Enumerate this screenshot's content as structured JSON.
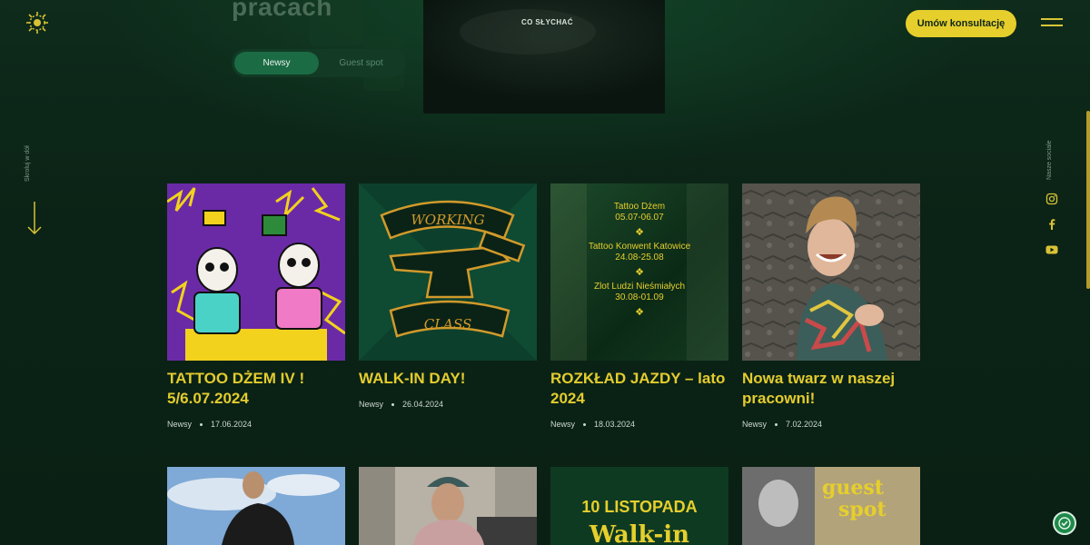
{
  "header": {
    "hero_title": "pracach",
    "nav_label": "CO SŁYCHAĆ",
    "cta_label": "Umów konsultację"
  },
  "tabs": [
    {
      "label": "Newsy"
    },
    {
      "label": "Guest spot"
    }
  ],
  "side": {
    "scroll_label": "Skroluj w dół",
    "social_label": "Nasze sociale"
  },
  "icons": {
    "logo": "sun-mandala-logo",
    "menu": "hamburger-icon",
    "scroll": "arrow-down-icon",
    "social": [
      "instagram-icon",
      "facebook-icon",
      "youtube-icon"
    ],
    "consent": "cookie-consent-icon"
  },
  "posts": [
    {
      "title": "TATTOO DŻEM IV ! 5/6.07.2024",
      "category": "Newsy",
      "date": "17.06.2024"
    },
    {
      "title": "WALK-IN DAY!",
      "category": "Newsy",
      "date": "26.04.2024"
    },
    {
      "title": "ROZKŁAD JAZDY – lato 2024",
      "category": "Newsy",
      "date": "18.03.2024",
      "image_lines": [
        "Tattoo Dżem",
        "05.07-06.07",
        "Tattoo Konwent Katowice",
        "24.08-25.08",
        "Zlot Ludzi Nieśmiałych",
        "30.08-01.09"
      ]
    },
    {
      "title": "Nowa twarz w naszej pracowni!",
      "category": "Newsy",
      "date": "7.02.2024"
    }
  ],
  "working_class_art": {
    "top": "WORKING",
    "bottom": "CLASS"
  },
  "row2": {
    "card3_line1": "10 LISTOPADA",
    "card3_line2": "Walk-in",
    "card4_line1": "guest",
    "card4_line2": "spot"
  },
  "colors": {
    "background": "#0b2316",
    "accent_yellow": "#e6cf2c",
    "tab_active": "#1b6b44"
  }
}
